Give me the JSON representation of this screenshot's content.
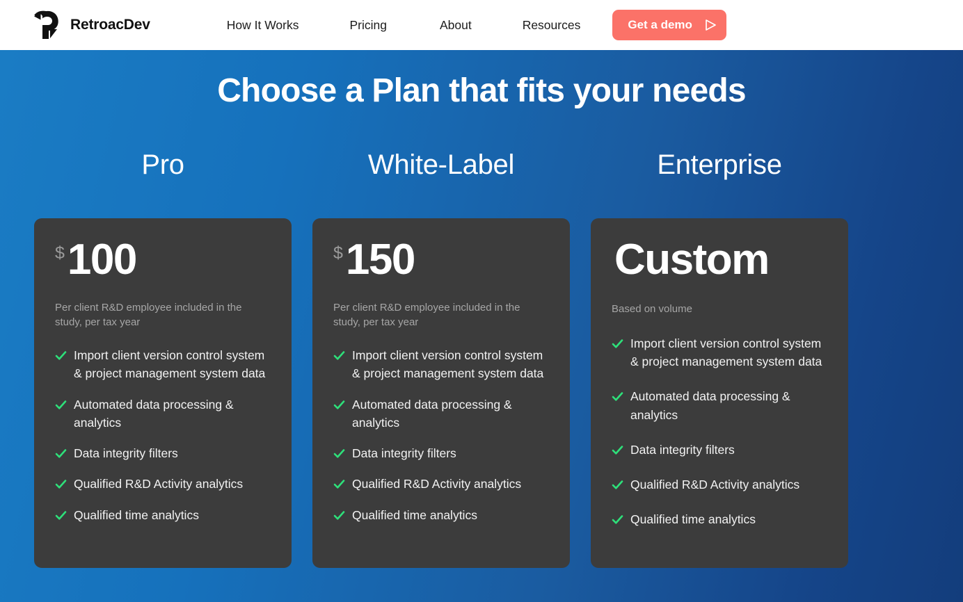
{
  "header": {
    "brand": {
      "name": "RetroacDev",
      "logo_icon": "retroac-r-arrow-logo"
    },
    "nav": [
      {
        "label": "How It Works"
      },
      {
        "label": "Pricing"
      },
      {
        "label": "About"
      },
      {
        "label": "Resources"
      }
    ],
    "cta": {
      "label": "Get a demo",
      "icon": "play-triangle-icon",
      "color": "#fb7268"
    }
  },
  "hero": {
    "title": "Choose a Plan that fits your needs",
    "background_from": "#1a7cc4",
    "background_to": "#133d7c",
    "card_background": "#3c3c3c",
    "check_color": "#2ee07a"
  },
  "plans": [
    {
      "name": "Pro",
      "currency": "$",
      "amount": "100",
      "note": "Per client R&D employee included in the study, per tax year",
      "features": [
        "Import client version control system & project management system data",
        "Automated data processing & analytics",
        "Data integrity filters",
        "Qualified R&D Activity analytics",
        "Qualified time analytics"
      ]
    },
    {
      "name": "White-Label",
      "currency": "$",
      "amount": "150",
      "note": "Per client R&D employee included in the study, per tax year",
      "features": [
        "Import client version control system & project management system data",
        "Automated data processing & analytics",
        "Data integrity filters",
        "Qualified R&D Activity analytics",
        "Qualified time analytics"
      ]
    },
    {
      "name": "Enterprise",
      "currency": "",
      "amount": "Custom",
      "note": "Based on volume",
      "features": [
        "Import client version control system & project management system data",
        "Automated data processing & analytics",
        "Data integrity filters",
        "Qualified R&D Activity analytics",
        "Qualified time analytics"
      ]
    }
  ]
}
